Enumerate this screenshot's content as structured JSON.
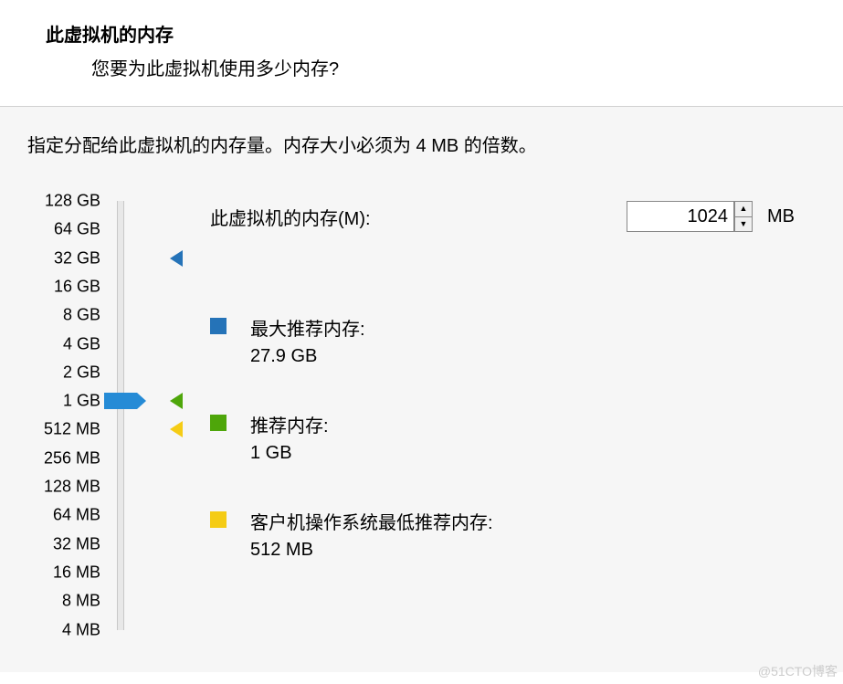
{
  "header": {
    "title": "此虚拟机的内存",
    "subtitle": "您要为此虚拟机使用多少内存?"
  },
  "instruction": "指定分配给此虚拟机的内存量。内存大小必须为 4 MB 的倍数。",
  "memory_field": {
    "label": "此虚拟机的内存(M):",
    "value": "1024",
    "unit": "MB"
  },
  "slider": {
    "ticks": [
      "128 GB",
      "64 GB",
      "32 GB",
      "16 GB",
      "8 GB",
      "4 GB",
      "2 GB",
      "1 GB",
      "512 MB",
      "256 MB",
      "128 MB",
      "64 MB",
      "32 MB",
      "16 MB",
      "8 MB",
      "4 MB"
    ],
    "current_index": 7
  },
  "markers": {
    "max": {
      "tick_index": 2,
      "color": "blue"
    },
    "recommended": {
      "tick_index": 7,
      "color": "green"
    },
    "min": {
      "tick_index": 8,
      "color": "yellow"
    }
  },
  "legend": {
    "max": {
      "label": "最大推荐内存:",
      "value": "27.9 GB"
    },
    "recommended": {
      "label": "推荐内存:",
      "value": "1 GB"
    },
    "min": {
      "label": "客户机操作系统最低推荐内存:",
      "value": "512 MB"
    }
  },
  "watermark": "@51CTO博客"
}
